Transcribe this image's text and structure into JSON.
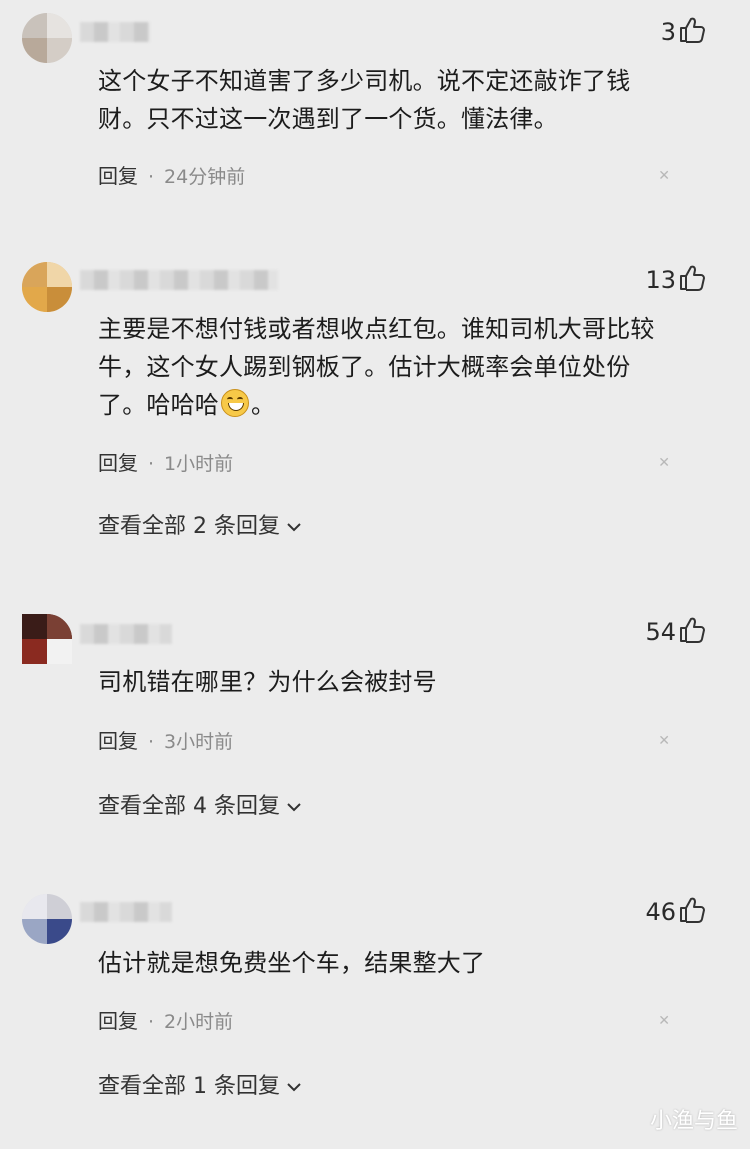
{
  "comments": [
    {
      "likes": "3",
      "text": "这个女子不知道害了多少司机。说不定还敲诈了钱财。只不过这一次遇到了一个货。懂法律。",
      "reply_label": "回复",
      "time": "24分钟前"
    },
    {
      "likes": "13",
      "text": "主要是不想付钱或者想收点红包。谁知司机大哥比较牛，这个女人踢到钢板了。估计大概率会单位处份了。哈哈哈",
      "text_suffix": "。",
      "reply_label": "回复",
      "time": "1小时前",
      "view_replies": "查看全部 2 条回复"
    },
    {
      "likes": "54",
      "text": "司机错在哪里？为什么会被封号",
      "reply_label": "回复",
      "time": "3小时前",
      "view_replies": "查看全部 4 条回复"
    },
    {
      "likes": "46",
      "text": "估计就是想免费坐个车，结果整大了",
      "reply_label": "回复",
      "time": "2小时前",
      "view_replies": "查看全部 1 条回复"
    }
  ],
  "icons": {
    "like": "thumbs-up-icon",
    "more": "close-icon",
    "expand": "chevron-down-icon",
    "emoji": "grin-emoji-icon"
  },
  "watermark": "小渔与鱼",
  "colors": {
    "background": "#ececec",
    "text": "#1c1c1c",
    "meta": "#8a8a8a"
  }
}
